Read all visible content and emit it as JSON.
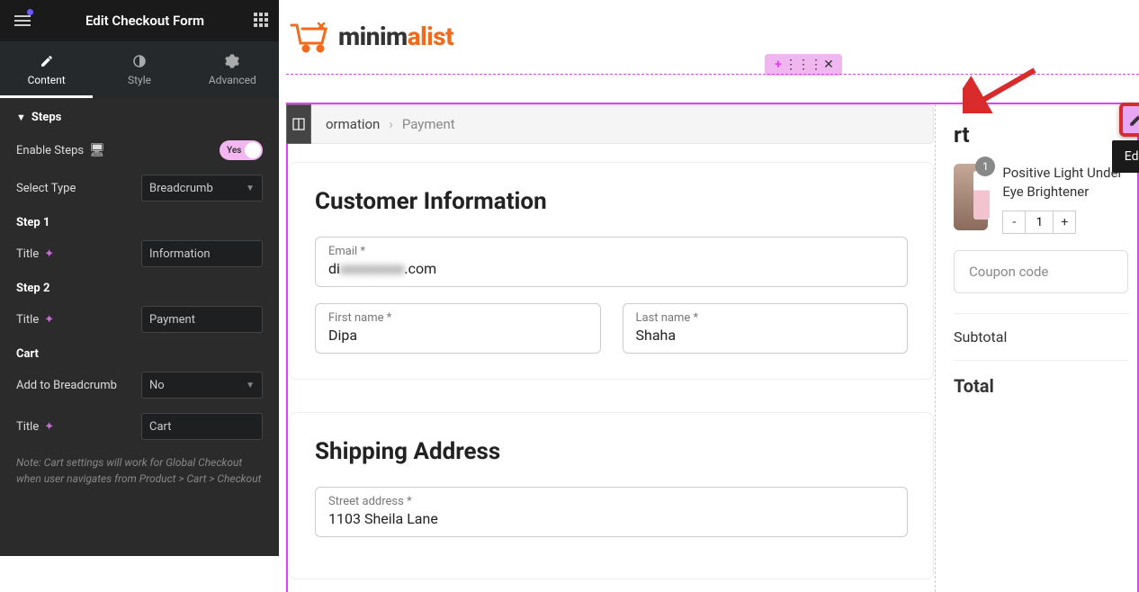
{
  "header": {
    "title": "Edit Checkout Form"
  },
  "tabs": {
    "content": "Content",
    "style": "Style",
    "advanced": "Advanced"
  },
  "section": {
    "title": "Steps"
  },
  "fields": {
    "enable_label": "Enable Steps",
    "toggle_yes": "Yes",
    "select_type_label": "Select Type",
    "select_type_value": "Breadcrumb",
    "step1": "Step 1",
    "step1_title_label": "Title",
    "step1_title_value": "Information",
    "step2": "Step 2",
    "step2_title_label": "Title",
    "step2_title_value": "Payment",
    "cart_head": "Cart",
    "add_breadcrumb_label": "Add to Breadcrumb",
    "add_breadcrumb_value": "No",
    "cart_title_label": "Title",
    "cart_title_value": "Cart",
    "note": "Note: Cart settings will work for Global Checkout when user navigates from Product > Cart > Checkout"
  },
  "brand": {
    "part1": "minim",
    "part2": "alist"
  },
  "breadcrumb": {
    "step1_partial": "ormation",
    "step2": "Payment"
  },
  "form": {
    "customer_h": "Customer Information",
    "email_label": "Email *",
    "email_value_prefix": "di",
    "email_value_suffix": ".com",
    "first_label": "First name *",
    "first_value": "Dipa",
    "last_label": "Last name *",
    "last_value": "Shaha",
    "shipping_h": "Shipping Address",
    "street_label": "Street address *",
    "street_value": "1103 Sheila Lane"
  },
  "tooltip": "Edit Checkout Form",
  "cart": {
    "title_suffix": "rt",
    "badge": "1",
    "product": "Positive Light Under Eye Brightener",
    "minus": "-",
    "qty": "1",
    "plus": "+",
    "coupon_ph": "Coupon code",
    "subtotal": "Subtotal",
    "total": "Total"
  }
}
